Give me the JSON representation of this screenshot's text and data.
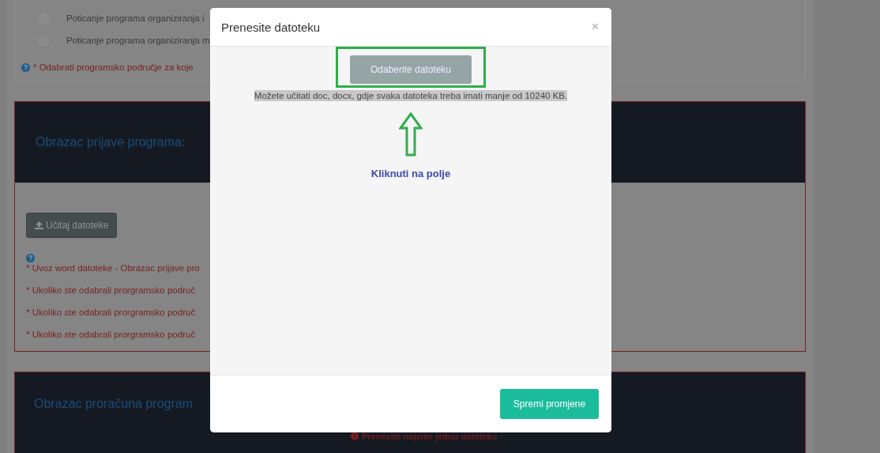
{
  "background": {
    "options": [
      {
        "label": "Poticanje programa organiziranja i",
        "selected": false
      },
      {
        "label": "Poticanje programa organiziranja m",
        "selected": false
      }
    ],
    "hint": "* Odabrati programsko područje za koje",
    "application_form": {
      "title": "Obrazac prijave programa:",
      "upload_button": "Učitaj datoteke",
      "notes": [
        "* Uvoz word datoteke - Obrazac prijave pro",
        "* Ukoliko ste odabrali prorgramsko područ",
        "* Ukoliko ste odabrali prorgramsko područ",
        "* Ukoliko ste odabrali prorgramsko područ"
      ]
    },
    "budget_form": {
      "title": "Obrazac proračuna program",
      "error": "Prenesite najviše jednu datoteku"
    }
  },
  "modal": {
    "title": "Prenesite datoteku",
    "close": "×",
    "choose_button": "Odaberite datoteku",
    "info": "Možete učitati doc, docx, gdje svaka datoteka treba imati manje od 10240 KB.",
    "annotation": "Kliknuti na polje",
    "save_button": "Spremi promjene"
  }
}
